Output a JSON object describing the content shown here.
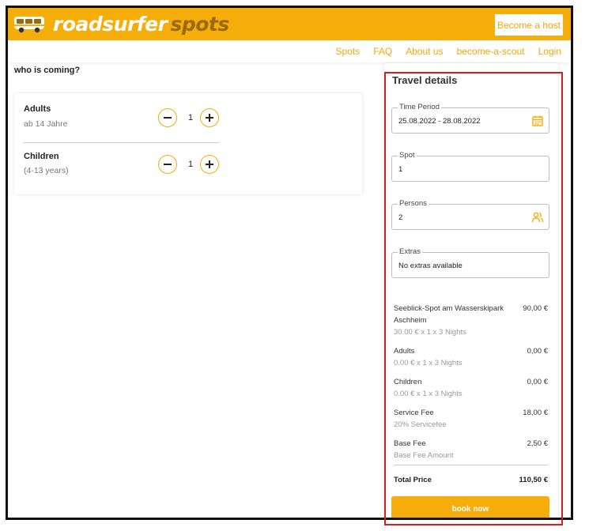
{
  "header": {
    "logo_primary": "roadsurfer",
    "logo_secondary": "spots",
    "become_host_label": "Become a host"
  },
  "nav": {
    "items": [
      "Spots",
      "FAQ",
      "About us",
      "become-a-scout",
      "Login"
    ]
  },
  "guests": {
    "title": "who is coming?",
    "adults": {
      "label": "Adults",
      "sub": "ab 14 Jahre",
      "value": "1"
    },
    "children": {
      "label": "Children",
      "sub": "(4-13 years)",
      "value": "1"
    }
  },
  "travel_details": {
    "title": "Travel details",
    "time_period": {
      "legend": "Time Period",
      "value": "25.08.2022 - 28.08.2022",
      "icon": "calendar-icon"
    },
    "spot": {
      "legend": "Spot",
      "value": "1"
    },
    "persons": {
      "legend": "Persons",
      "value": "2",
      "icon": "persons-icon"
    },
    "extras": {
      "legend": "Extras",
      "value": "No extras available"
    }
  },
  "pricing": {
    "items": [
      {
        "name": "Seeblick-Spot am Wasserskipark Aschheim",
        "detail": "30.00 € x 1 x 3 Nights",
        "amount": "90,00 €"
      },
      {
        "name": "Adults",
        "detail": "0.00 € x 1 x 3 Nights",
        "amount": "0,00 €"
      },
      {
        "name": "Children",
        "detail": "0.00 € x 1 x 3 Nights",
        "amount": "0,00 €"
      },
      {
        "name": "Service Fee",
        "detail": "20% Servicefee",
        "amount": "18,00 €"
      },
      {
        "name": "Base Fee",
        "detail": "Base Fee Amount",
        "amount": "2,50 €"
      }
    ],
    "total_label": "Total Price",
    "total_amount": "110,50 €",
    "book_label": "book now"
  },
  "colors": {
    "brand": "#f5ad0a",
    "highlight_border": "#d81d1d"
  }
}
